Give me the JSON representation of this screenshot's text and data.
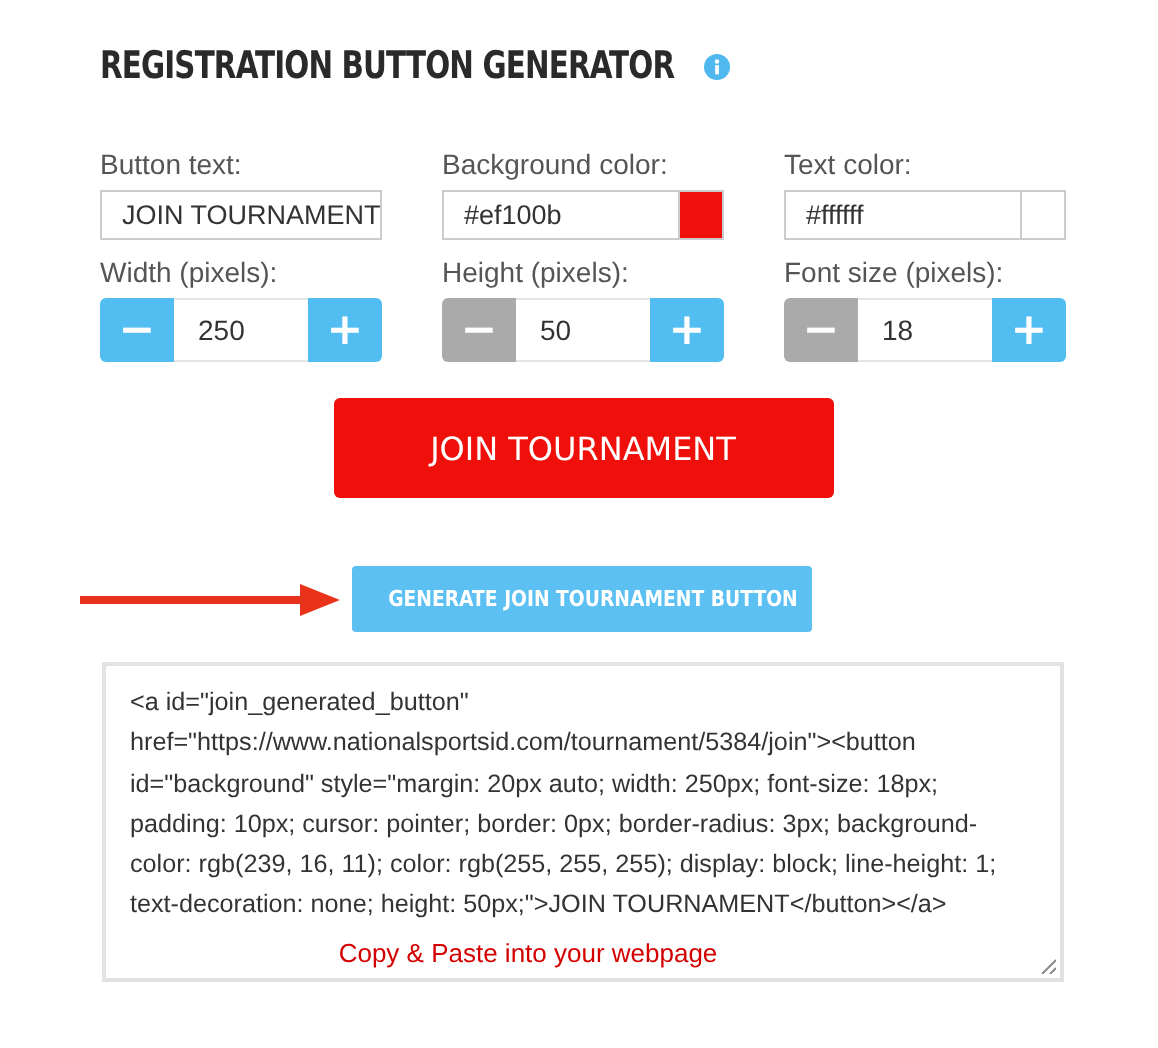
{
  "title": "REGISTRATION BUTTON GENERATOR",
  "fields": [
    {
      "kind": "text",
      "label": "Button text:",
      "value": "JOIN TOURNAMENT"
    },
    {
      "kind": "color",
      "label": "Background color:",
      "value": "#ef100b",
      "color": "#ef100b"
    },
    {
      "kind": "color",
      "label": "Text color:",
      "value": "#ffffff",
      "color": "#ffffff"
    }
  ],
  "steppers": [
    {
      "label": "Width (pixels):",
      "value": "250",
      "minus_disabled": false,
      "minus": "−",
      "plus": "+"
    },
    {
      "label": "Height (pixels):",
      "value": "50",
      "minus_disabled": true,
      "minus": "−",
      "plus": "+"
    },
    {
      "label": "Font size (pixels):",
      "value": "18",
      "minus_disabled": true,
      "minus": "−",
      "plus": "+"
    }
  ],
  "preview": {
    "label": "JOIN TOURNAMENT"
  },
  "generate_button": "GENERATE JOIN TOURNAMENT BUTTON",
  "code": "<a id=\"join_generated_button\" href=\"https://www.nationalsportsid.com/tournament/5384/join\"><button id=\"background\" style=\"margin: 20px auto; width: 250px; font-size: 18px; padding: 10px; cursor: pointer; border: 0px; border-radius: 3px; background-color: rgb(239, 16, 11); color: rgb(255, 255, 255); display: block; line-height: 1; text-decoration: none; height: 50px;\">JOIN TOURNAMENT</button></a>",
  "note": "Copy & Paste into your webpage"
}
